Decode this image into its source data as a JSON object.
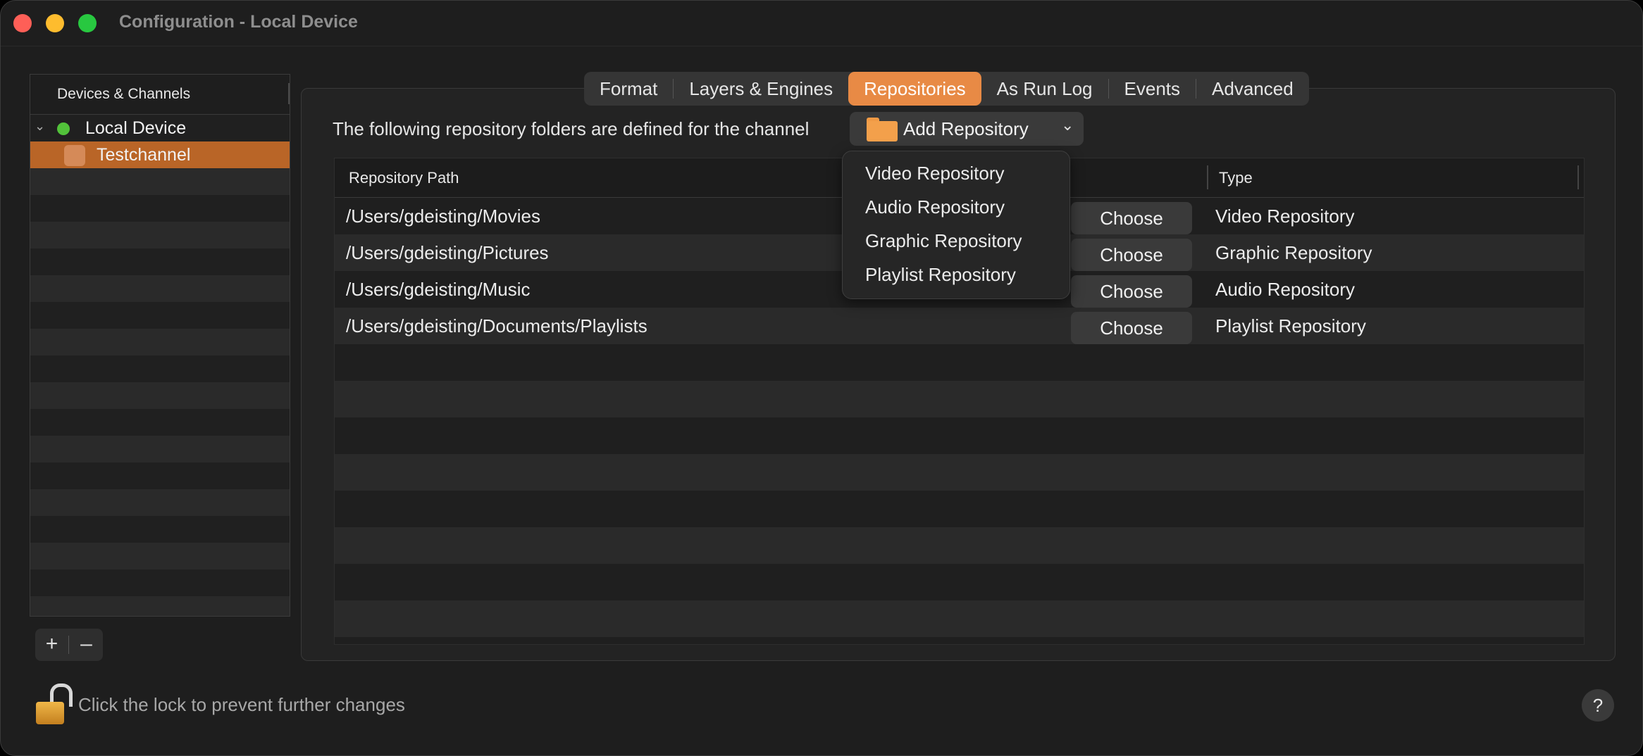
{
  "window": {
    "title": "Configuration - Local Device"
  },
  "sidebar": {
    "header": "Devices & Channels",
    "device": {
      "label": "Local Device",
      "status_color": "#52c23a"
    },
    "channel": {
      "label": "Testchannel",
      "selected_color": "#b96527"
    },
    "add_label": "+",
    "remove_label": "–"
  },
  "tabs": [
    {
      "label": "Format",
      "active": false
    },
    {
      "label": "Layers & Engines",
      "active": false
    },
    {
      "label": "Repositories",
      "active": true
    },
    {
      "label": "As Run Log",
      "active": false
    },
    {
      "label": "Events",
      "active": false
    },
    {
      "label": "Advanced",
      "active": false
    }
  ],
  "repositories": {
    "description": "The following repository folders are defined for the channel",
    "add_button": "Add Repository",
    "columns": {
      "path": "Repository Path",
      "type": "Type"
    },
    "choose_label": "Choose",
    "rows": [
      {
        "path": "/Users/gdeisting/Movies",
        "type": "Video Repository"
      },
      {
        "path": "/Users/gdeisting/Pictures",
        "type": "Graphic Repository"
      },
      {
        "path": "/Users/gdeisting/Music",
        "type": "Audio Repository"
      },
      {
        "path": "/Users/gdeisting/Documents/Playlists",
        "type": "Playlist Repository"
      }
    ],
    "menu_items": [
      "Video Repository",
      "Audio Repository",
      "Graphic Repository",
      "Playlist Repository"
    ]
  },
  "footer": {
    "lock_text": "Click the lock to prevent further changes",
    "help_label": "?"
  },
  "accent_color": "#e88a45"
}
